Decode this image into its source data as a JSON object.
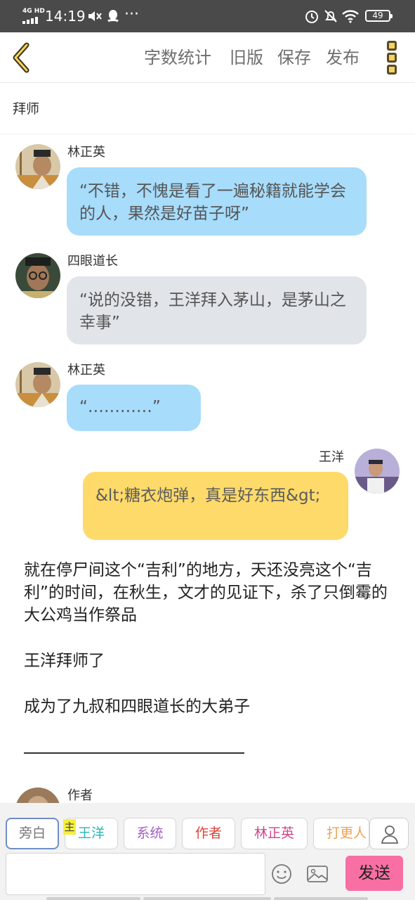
{
  "status_bar": {
    "network": "4G HD",
    "time": "14:19",
    "battery": "49",
    "icons": [
      "signal-icon",
      "mute-icon",
      "qq-icon",
      "more-dots-icon",
      "alarm-icon",
      "dnd-icon",
      "wifi-icon",
      "battery-icon"
    ],
    "more_dots": "···"
  },
  "header": {
    "word_count": "字数统计",
    "old_version": "旧版",
    "save": "保存",
    "publish": "发布",
    "accent_color": "#f5d35b"
  },
  "chapter_title": "拜师",
  "messages": [
    {
      "speaker": "林正英",
      "text": "“不错，不愧是看了一遍秘籍就能学会的人，果然是好苗子呀”"
    },
    {
      "speaker": "四眼道长",
      "text": "“说的没错，王洋拜入茅山，是茅山之幸事”"
    },
    {
      "speaker": "林正英",
      "text": "“…………”"
    },
    {
      "speaker": "王洋",
      "text": "&lt;糖衣炮弹，真是好东西&gt;"
    }
  ],
  "narration": [
    "就在停尸间这个“吉利”的地方，天还没亮这个“吉利”的时间，在秋生，文才的见证下，杀了只倒霉的大公鸡当作祭品",
    "王洋拜师了",
    "成为了九叔和四眼道长的大弟子"
  ],
  "partial_speaker": "作者",
  "roles": [
    {
      "label": "旁白",
      "color": "#777777"
    },
    {
      "label": "王洋",
      "color": "#2bb5b5"
    },
    {
      "label": "系统",
      "color": "#a35fc0"
    },
    {
      "label": "作者",
      "color": "#d9443a"
    },
    {
      "label": "林正英",
      "color": "#d0458b"
    },
    {
      "label": "打更人",
      "color": "#f0a050"
    }
  ],
  "main_role_badge": "主",
  "input": {
    "value": "",
    "placeholder": ""
  },
  "send_label": "发送",
  "bubble_colors": {
    "lin": "#a7dcfb",
    "siyan": "#e1e5ea",
    "wang": "#fdda6a"
  },
  "send_color": "#f86fa4"
}
